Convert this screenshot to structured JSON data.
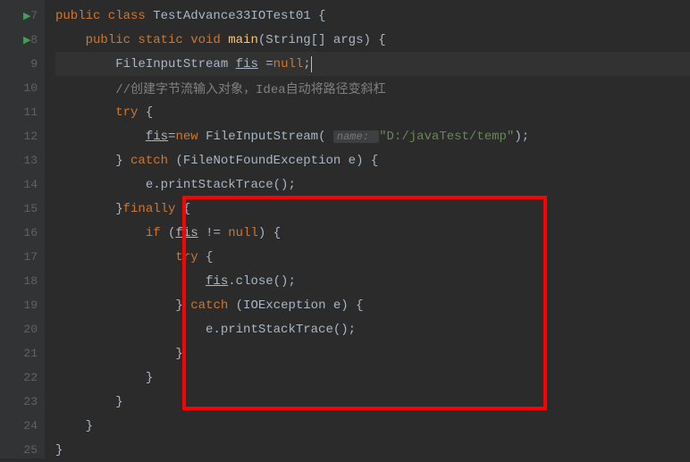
{
  "lines": [
    {
      "num": "7",
      "run": true,
      "code": [
        {
          "t": "kw",
          "v": "public class "
        },
        {
          "t": "",
          "v": "TestAdvance33IOTest01 {"
        }
      ]
    },
    {
      "num": "8",
      "run": true,
      "indent": 1,
      "code": [
        {
          "t": "kw",
          "v": "public static void "
        },
        {
          "t": "method",
          "v": "main"
        },
        {
          "t": "",
          "v": "(String[] args) {"
        }
      ]
    },
    {
      "num": "9",
      "current": true,
      "indent": 2,
      "code": [
        {
          "t": "",
          "v": "FileInputStream "
        },
        {
          "t": "underline",
          "v": "fis"
        },
        {
          "t": "",
          "v": " ="
        },
        {
          "t": "kw",
          "v": "null"
        },
        {
          "t": "",
          "v": ";"
        },
        {
          "t": "cursor",
          "v": ""
        }
      ]
    },
    {
      "num": "10",
      "indent": 2,
      "code": [
        {
          "t": "comment",
          "v": "//创建字节流输入对象，Idea自动将路径变斜杠"
        }
      ]
    },
    {
      "num": "11",
      "indent": 2,
      "code": [
        {
          "t": "kw",
          "v": "try "
        },
        {
          "t": "",
          "v": "{"
        }
      ]
    },
    {
      "num": "12",
      "indent": 3,
      "code": [
        {
          "t": "underline",
          "v": "fis"
        },
        {
          "t": "",
          "v": "="
        },
        {
          "t": "kw",
          "v": "new "
        },
        {
          "t": "",
          "v": "FileInputStream( "
        },
        {
          "t": "hint",
          "v": "name: "
        },
        {
          "t": "string",
          "v": "\"D:/javaTest/temp\""
        },
        {
          "t": "",
          "v": ");"
        }
      ]
    },
    {
      "num": "13",
      "indent": 2,
      "code": [
        {
          "t": "",
          "v": "} "
        },
        {
          "t": "kw",
          "v": "catch "
        },
        {
          "t": "",
          "v": "(FileNotFoundException e) {"
        }
      ]
    },
    {
      "num": "14",
      "indent": 3,
      "code": [
        {
          "t": "",
          "v": "e.printStackTrace();"
        }
      ]
    },
    {
      "num": "15",
      "indent": 2,
      "code": [
        {
          "t": "",
          "v": "}"
        },
        {
          "t": "kw",
          "v": "finally "
        },
        {
          "t": "",
          "v": "{"
        }
      ]
    },
    {
      "num": "16",
      "indent": 3,
      "code": [
        {
          "t": "kw",
          "v": "if "
        },
        {
          "t": "",
          "v": "("
        },
        {
          "t": "underline",
          "v": "fis"
        },
        {
          "t": "",
          "v": " != "
        },
        {
          "t": "kw",
          "v": "null"
        },
        {
          "t": "",
          "v": ") {"
        }
      ]
    },
    {
      "num": "17",
      "indent": 4,
      "code": [
        {
          "t": "kw",
          "v": "try "
        },
        {
          "t": "",
          "v": "{"
        }
      ]
    },
    {
      "num": "18",
      "indent": 5,
      "code": [
        {
          "t": "underline",
          "v": "fis"
        },
        {
          "t": "",
          "v": ".close();"
        }
      ]
    },
    {
      "num": "19",
      "indent": 4,
      "code": [
        {
          "t": "",
          "v": "} "
        },
        {
          "t": "kw",
          "v": "catch "
        },
        {
          "t": "",
          "v": "(IOException e) {"
        }
      ]
    },
    {
      "num": "20",
      "indent": 5,
      "code": [
        {
          "t": "",
          "v": "e.printStackTrace();"
        }
      ]
    },
    {
      "num": "21",
      "indent": 4,
      "code": [
        {
          "t": "",
          "v": "}"
        }
      ]
    },
    {
      "num": "22",
      "indent": 3,
      "code": [
        {
          "t": "",
          "v": "}"
        }
      ]
    },
    {
      "num": "23",
      "indent": 2,
      "code": [
        {
          "t": "",
          "v": "}"
        }
      ]
    },
    {
      "num": "24",
      "indent": 1,
      "code": [
        {
          "t": "",
          "v": "}"
        }
      ]
    },
    {
      "num": "25",
      "indent": 0,
      "code": [
        {
          "t": "",
          "v": "}"
        }
      ]
    }
  ]
}
